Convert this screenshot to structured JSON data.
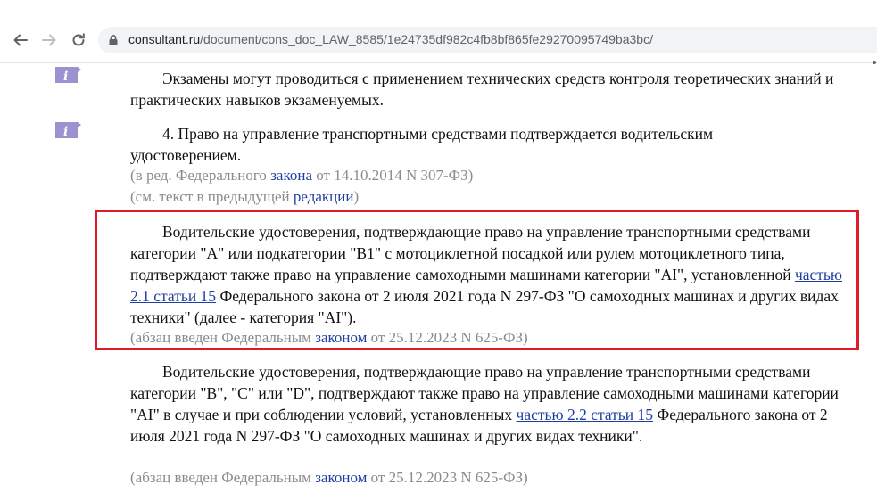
{
  "browser": {
    "url_domain": "consultant.ru",
    "url_path": "/document/cons_doc_LAW_8585/1e24735df982c4fb8bf865fe29270095749ba3bc/"
  },
  "doc": {
    "p1": "Экзамены могут проводиться с применением технических средств контроля теоретических знаний и практических навыков экзаменуемых.",
    "p2": "4. Право на управление транспортными средствами подтверждается водительским удостоверением.",
    "note1": {
      "pre": "(в ред. Федерального ",
      "link": "закона",
      "post": " от 14.10.2014 N 307-ФЗ)"
    },
    "note2": {
      "pre": "(см. текст в предыдущей ",
      "link": "редакции",
      "post": ")"
    },
    "p3": {
      "pre": "Водительские удостоверения, подтверждающие право на управление транспортными средствами категории \"A\" или подкатегории \"B1\" с мотоциклетной посадкой или рулем мотоциклетного типа, подтверждают также право на управление самоходными машинами категории \"AI\", установленной ",
      "link": "частью 2.1 статьи 15",
      "post": " Федерального закона от 2 июля 2021 года N 297-ФЗ \"О самоходных машинах и других видах техники\" (далее - категория \"AI\")."
    },
    "note3": {
      "pre": "(абзац введен Федеральным ",
      "link": "законом",
      "post": " от 25.12.2023 N 625-ФЗ)"
    },
    "p4": {
      "pre": "Водительские удостоверения, подтверждающие право на управление транспортными средствами категории \"B\", \"C\" или \"D\", подтверждают также право на управление самоходными машинами категории \"AI\" в случае и при соблюдении условий, установленных ",
      "link": "частью 2.2 статьи 15",
      "post": " Федерального закона от 2 июля 2021 года N 297-ФЗ \"О самоходных машинах и других видах техники\"."
    },
    "note4": {
      "pre": "(абзац введен Федеральным ",
      "link": "законом",
      "post": " от 25.12.2023 N 625-ФЗ)"
    }
  },
  "colors": {
    "highlight": "#e01b24",
    "link": "#1f3fa0",
    "info_icon": "#9b93d0"
  }
}
